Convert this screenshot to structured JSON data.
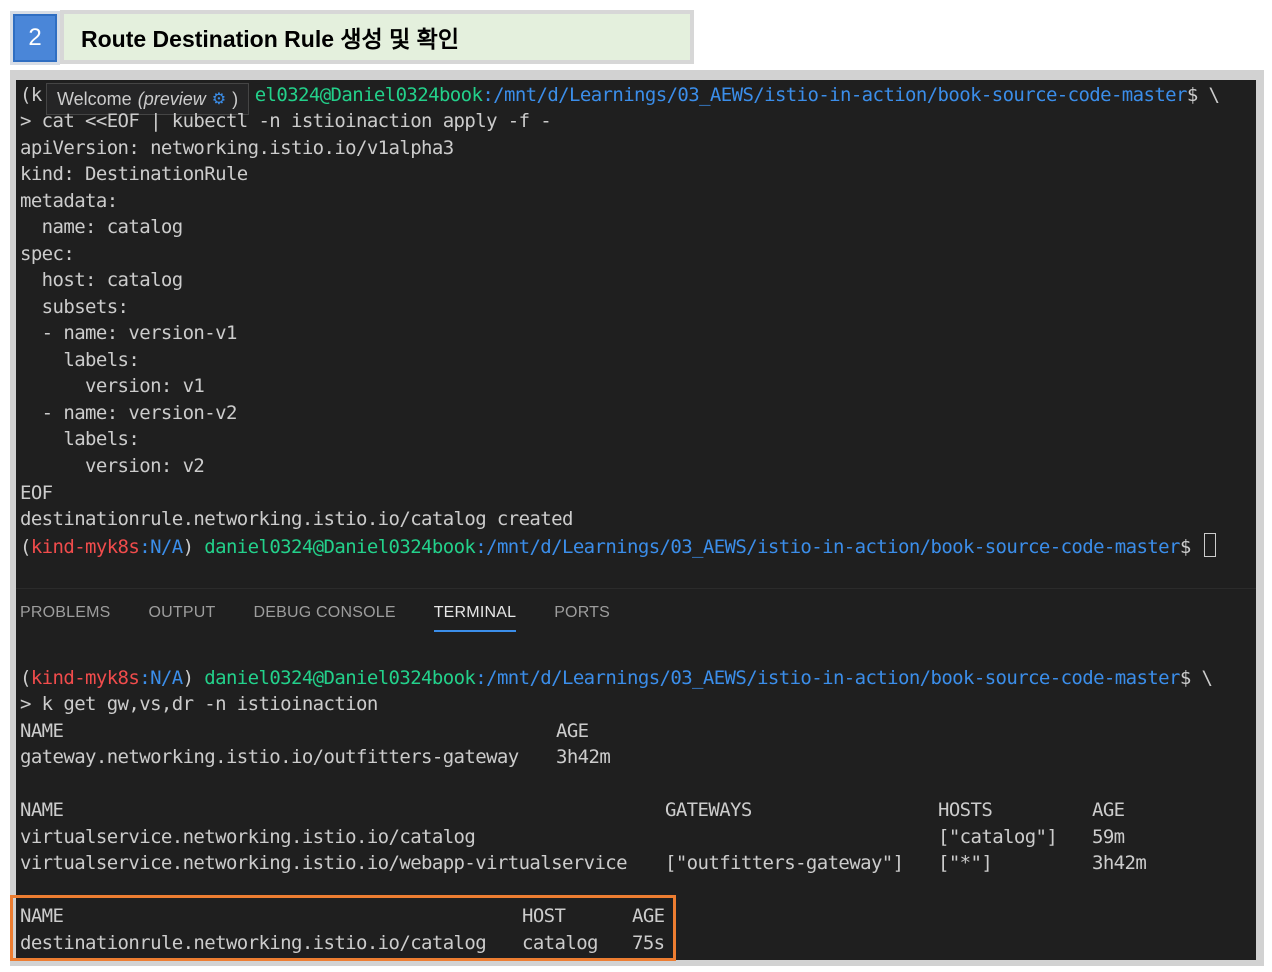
{
  "step": {
    "number": "2"
  },
  "heading": "Route Destination Rule 생성 및 확인",
  "hover": {
    "label": "Welcome",
    "badge": "(preview",
    "end": ")"
  },
  "upper": {
    "prompt_line1_rest": "el0324@Daniel0324book",
    "prompt_line1_path": ":/mnt/d/Learnings/03_AEWS/istio-in-action/book-source-code-master",
    "prompt_line1_tail": "$ \\",
    "prompt_line1_start": "(k",
    "lines": [
      "> cat <<EOF | kubectl -n istioinaction apply -f -",
      "apiVersion: networking.istio.io/v1alpha3",
      "kind: DestinationRule",
      "metadata:",
      "  name: catalog",
      "spec:",
      "  host: catalog",
      "  subsets:",
      "  - name: version-v1",
      "    labels:",
      "      version: v1",
      "  - name: version-v2",
      "    labels:",
      "      version: v2",
      "EOF",
      "destinationrule.networking.istio.io/catalog created"
    ],
    "prompt2": {
      "open": "(",
      "context": "kind-myk8s",
      "ns": ":N/A",
      "close": ") ",
      "user": "daniel0324@Daniel0324book",
      "path": ":/mnt/d/Learnings/03_AEWS/istio-in-action/book-source-code-master",
      "tail": "$ "
    }
  },
  "tabs": [
    "PROBLEMS",
    "OUTPUT",
    "DEBUG CONSOLE",
    "TERMINAL",
    "PORTS"
  ],
  "lower": {
    "prompt": {
      "open": "(",
      "context": "kind-myk8s",
      "ns": ":N/A",
      "close": ") ",
      "user": "daniel0324@Daniel0324book",
      "path": ":/mnt/d/Learnings/03_AEWS/istio-in-action/book-source-code-master",
      "tail": "$ \\"
    },
    "command": "> k get gw,vs,dr -n istioinaction",
    "gw": {
      "headers": [
        "NAME",
        "AGE"
      ],
      "rows": [
        [
          "gateway.networking.istio.io/outfitters-gateway",
          "3h42m"
        ]
      ]
    },
    "vs": {
      "headers": [
        "NAME",
        "GATEWAYS",
        "HOSTS",
        "AGE"
      ],
      "rows": [
        [
          "virtualservice.networking.istio.io/catalog",
          "",
          "[\"catalog\"]",
          "59m"
        ],
        [
          "virtualservice.networking.istio.io/webapp-virtualservice",
          "[\"outfitters-gateway\"]",
          "[\"*\"]",
          "3h42m"
        ]
      ]
    },
    "dr": {
      "headers": [
        "NAME",
        "HOST",
        "AGE"
      ],
      "rows": [
        [
          "destinationrule.networking.istio.io/catalog",
          "catalog",
          "75s"
        ]
      ]
    }
  },
  "colors": {
    "context": "#f14c4c",
    "user": "#23d18b",
    "path": "#3b8eea",
    "highlight": "#ed7d31"
  }
}
